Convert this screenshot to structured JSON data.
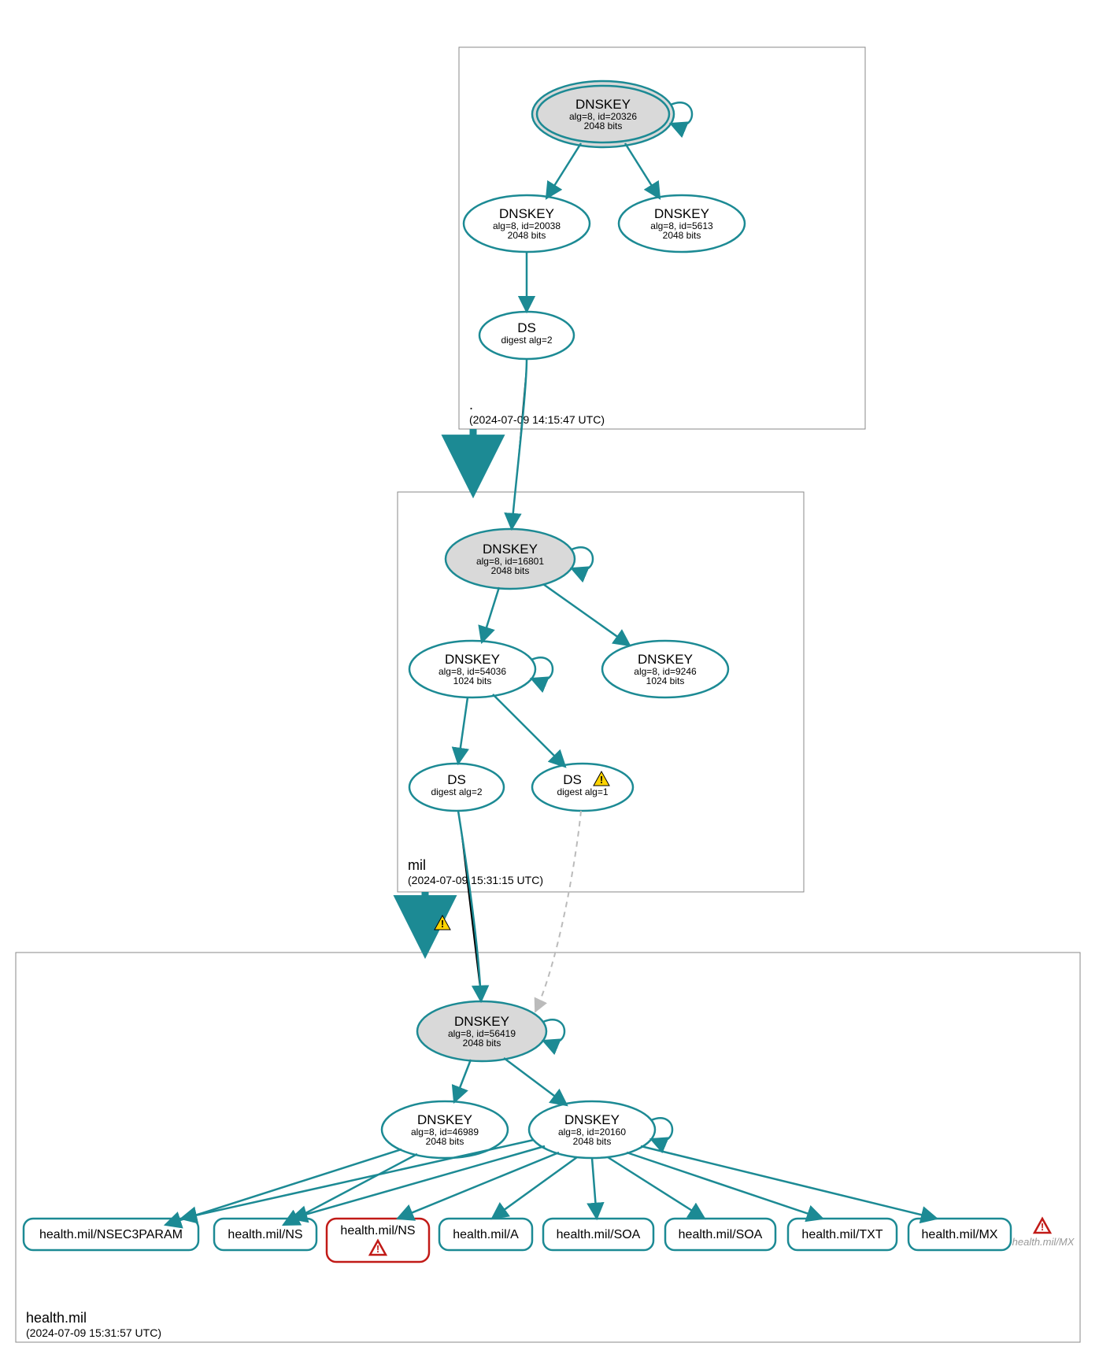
{
  "zones": {
    "root": {
      "label": ".",
      "timestamp": "(2024-07-09 14:15:47 UTC)",
      "dnskey_ksk": {
        "title": "DNSKEY",
        "detail": "alg=8, id=20326",
        "bits": "2048 bits"
      },
      "dnskey_zsk1": {
        "title": "DNSKEY",
        "detail": "alg=8, id=20038",
        "bits": "2048 bits"
      },
      "dnskey_zsk2": {
        "title": "DNSKEY",
        "detail": "alg=8, id=5613",
        "bits": "2048 bits"
      },
      "ds": {
        "title": "DS",
        "detail": "digest alg=2"
      }
    },
    "mil": {
      "label": "mil",
      "timestamp": "(2024-07-09 15:31:15 UTC)",
      "dnskey_ksk": {
        "title": "DNSKEY",
        "detail": "alg=8, id=16801",
        "bits": "2048 bits"
      },
      "dnskey_zsk1": {
        "title": "DNSKEY",
        "detail": "alg=8, id=54036",
        "bits": "1024 bits"
      },
      "dnskey_zsk2": {
        "title": "DNSKEY",
        "detail": "alg=8, id=9246",
        "bits": "1024 bits"
      },
      "ds1": {
        "title": "DS",
        "detail": "digest alg=2"
      },
      "ds2": {
        "title": "DS",
        "detail": "digest alg=1"
      }
    },
    "health": {
      "label": "health.mil",
      "timestamp": "(2024-07-09 15:31:57 UTC)",
      "dnskey_ksk": {
        "title": "DNSKEY",
        "detail": "alg=8, id=56419",
        "bits": "2048 bits"
      },
      "dnskey_zsk1": {
        "title": "DNSKEY",
        "detail": "alg=8, id=46989",
        "bits": "2048 bits"
      },
      "dnskey_zsk2": {
        "title": "DNSKEY",
        "detail": "alg=8, id=20160",
        "bits": "2048 bits"
      },
      "rr": {
        "r0": "health.mil/NSEC3PARAM",
        "r1": "health.mil/NS",
        "r2": "health.mil/NS",
        "r3": "health.mil/A",
        "r4": "health.mil/SOA",
        "r5": "health.mil/SOA",
        "r6": "health.mil/TXT",
        "r7": "health.mil/MX",
        "r8": "health.mil/MX"
      }
    }
  }
}
